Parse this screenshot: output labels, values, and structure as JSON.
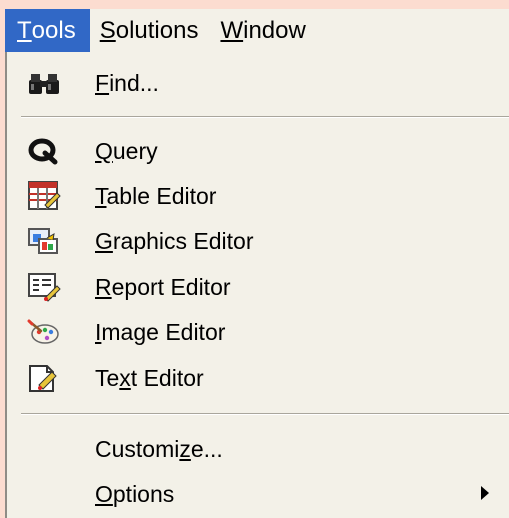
{
  "menubar": {
    "items": [
      {
        "mnemonic": "T",
        "rest": "ools"
      },
      {
        "mnemonic": "S",
        "rest": "olutions"
      },
      {
        "mnemonic": "W",
        "rest": "indow"
      }
    ]
  },
  "menu": {
    "find": {
      "pre": "",
      "mnemonic": "F",
      "post": "ind...",
      "icon": "binoculars-icon"
    },
    "query": {
      "pre": "",
      "mnemonic": "Q",
      "post": "uery",
      "icon": "query-icon"
    },
    "table_editor": {
      "pre": "",
      "mnemonic": "T",
      "post": "able Editor",
      "icon": "table-editor-icon"
    },
    "graphics_editor": {
      "pre": "",
      "mnemonic": "G",
      "post": "raphics Editor",
      "icon": "graphics-editor-icon"
    },
    "report_editor": {
      "pre": "",
      "mnemonic": "R",
      "post": "eport Editor",
      "icon": "report-editor-icon"
    },
    "image_editor": {
      "pre": "",
      "mnemonic": "I",
      "post": "mage Editor",
      "icon": "image-editor-icon"
    },
    "text_editor": {
      "pre": "Te",
      "mnemonic": "x",
      "post": "t Editor",
      "icon": "text-editor-icon"
    },
    "customize": {
      "pre": "Customi",
      "mnemonic": "z",
      "post": "e..."
    },
    "options": {
      "pre": "",
      "mnemonic": "O",
      "post": "ptions"
    }
  },
  "colors": {
    "highlight": "#3168c6",
    "menu_background": "#f3f1e8",
    "page_background": "#fcdcd0"
  }
}
